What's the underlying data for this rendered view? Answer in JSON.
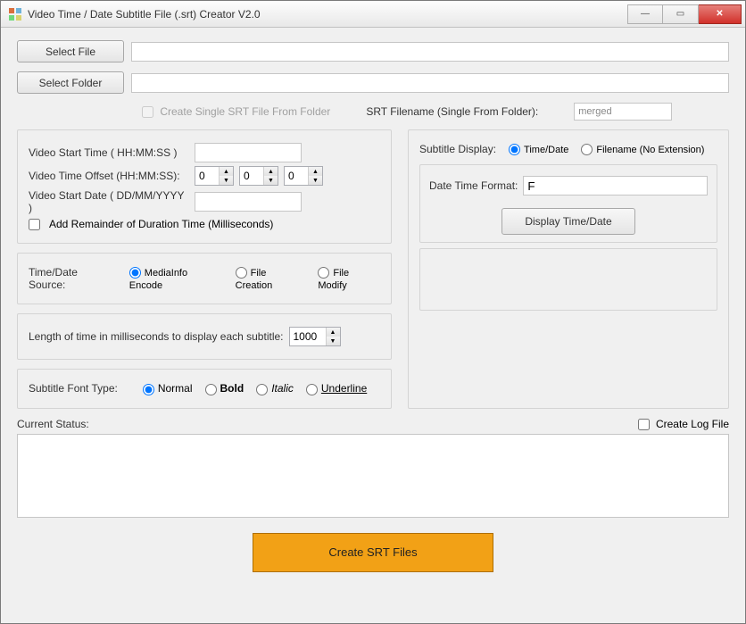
{
  "window": {
    "title": "Video Time / Date Subtitle File (.srt) Creator  V2.0"
  },
  "buttons": {
    "select_file": "Select File",
    "select_folder": "Select Folder",
    "display_time_date": "Display Time/Date",
    "create_srt": "Create SRT Files"
  },
  "inputs": {
    "file_path": "",
    "folder_path": "",
    "srt_filename": "merged",
    "video_start_time": "",
    "offset_h": "0",
    "offset_m": "0",
    "offset_s": "0",
    "video_start_date": "",
    "display_duration_ms": "1000",
    "date_time_format": "F"
  },
  "checkboxes": {
    "create_single_srt": {
      "label": "Create Single SRT File From Folder",
      "checked": false,
      "disabled": true
    },
    "add_remainder_ms": {
      "label": "Add Remainder of Duration Time (Milliseconds)",
      "checked": false
    },
    "create_log": {
      "label": "Create Log File",
      "checked": false
    }
  },
  "labels": {
    "srt_filename": "SRT Filename  (Single From Folder):",
    "video_start_time": "Video Start Time ( HH:MM:SS )",
    "video_time_offset": "Video Time Offset (HH:MM:SS):",
    "video_start_date": "Video Start Date (  DD/MM/YYYY )",
    "time_date_source": "Time/Date Source:",
    "display_length": "Length of time in milliseconds to display each subtitle:",
    "subtitle_font_type": "Subtitle Font Type:",
    "subtitle_display": "Subtitle Display:",
    "date_time_format": "Date Time Format:",
    "current_status": "Current Status:"
  },
  "radios": {
    "source": {
      "selected": "mediainfo",
      "options": {
        "mediainfo": "MediaInfo Encode",
        "creation": "File Creation",
        "modify": "File Modify"
      }
    },
    "font": {
      "selected": "normal",
      "options": {
        "normal": "Normal",
        "bold": "Bold",
        "italic": "Italic",
        "underline": "Underline"
      }
    },
    "display": {
      "selected": "timedate",
      "options": {
        "timedate": "Time/Date",
        "filename": "Filename (No Extension)"
      }
    }
  },
  "status_text": ""
}
